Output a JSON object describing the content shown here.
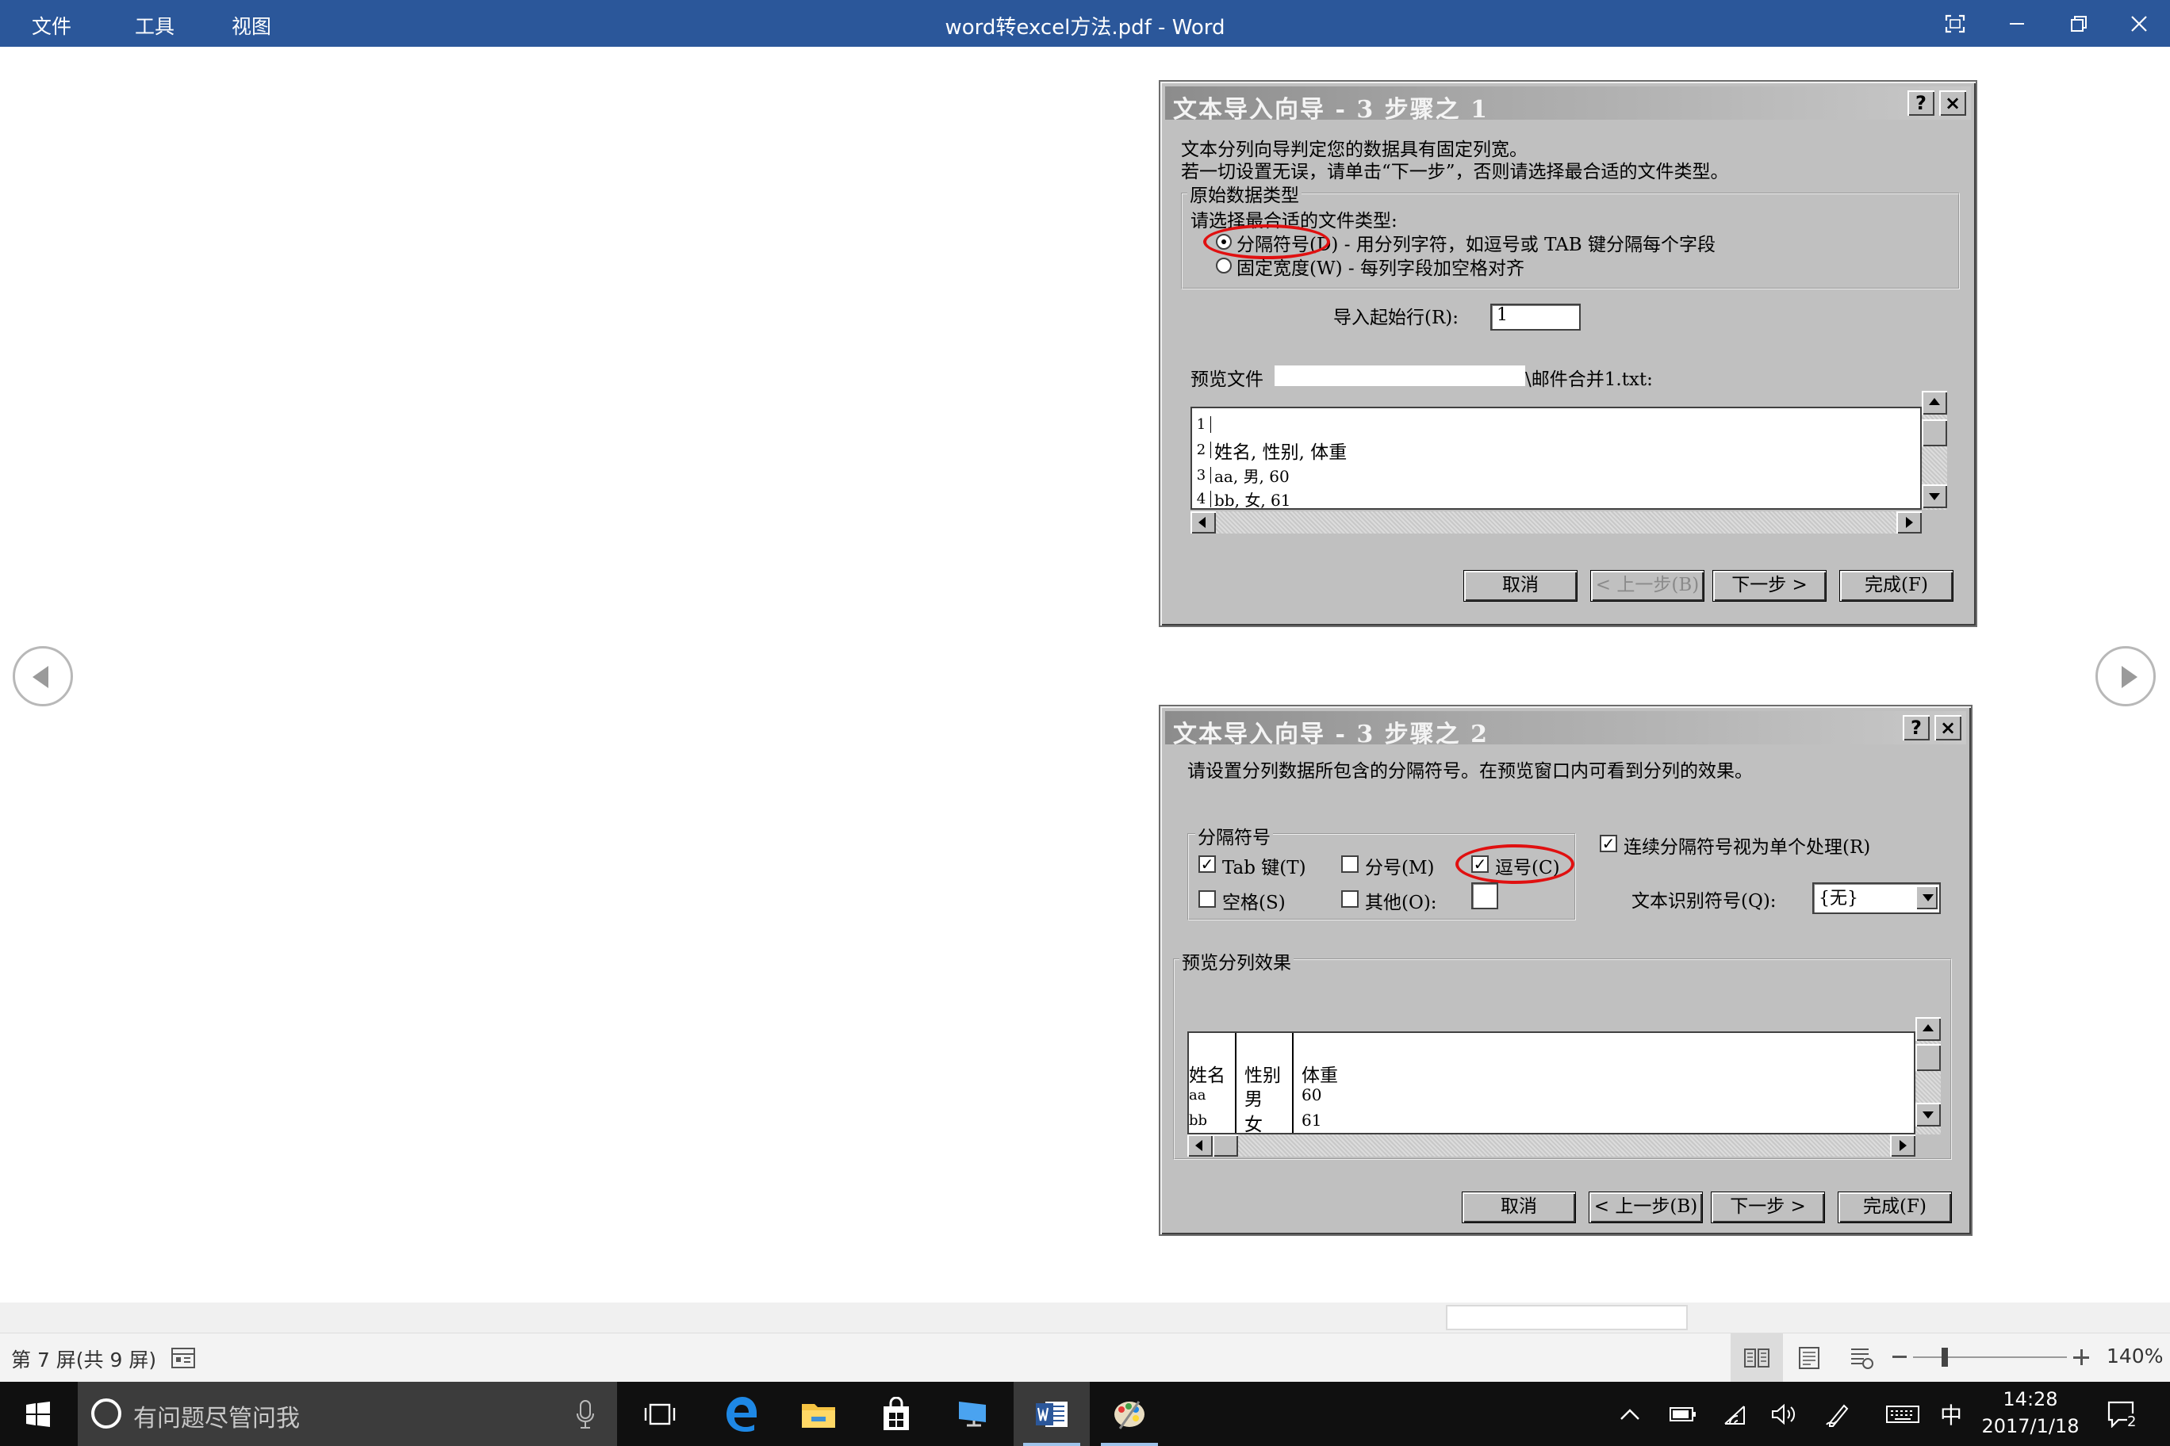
{
  "titlebar": {
    "menu": [
      "文件",
      "工具",
      "视图"
    ],
    "title": "word转excel方法.pdf  -  Word"
  },
  "dialog1": {
    "title": "文本导入向导 - 3 步骤之 1",
    "help": "?",
    "close": "×",
    "line1": "文本分列向导判定您的数据具有固定列宽。",
    "line2": "若一切设置无误，请单击“下一步”，否则请选择最合适的文件类型。",
    "group_label": "原始数据类型",
    "choose_label": "请选择最合适的文件类型:",
    "radio_delimited": "分隔符号(D) - 用分列字符，如逗号或 TAB 键分隔每个字段",
    "radio_fixed": "固定宽度(W) - 每列字段加空格对齐",
    "start_row_label": "导入起始行(R):",
    "start_row_value": "1",
    "preview_label": "预览文件",
    "preview_file": "\\邮件合并1.txt:",
    "preview_rows": [
      {
        "n": "1",
        "text": ""
      },
      {
        "n": "2",
        "text": "姓名, 性别, 体重"
      },
      {
        "n": "3",
        "text": "aa, 男, 60"
      },
      {
        "n": "4",
        "text": "bb, 女, 61"
      }
    ],
    "buttons": {
      "cancel": "取消",
      "back": "< 上一步(B)",
      "next": "下一步 >",
      "finish": "完成(F)"
    }
  },
  "dialog2": {
    "title": "文本导入向导 - 3 步骤之 2",
    "help": "?",
    "close": "×",
    "line1": "请设置分列数据所包含的分隔符号。在预览窗口内可看到分列的效果。",
    "group_label": "分隔符号",
    "chk_tab": "Tab 键(T)",
    "chk_semicolon": "分号(M)",
    "chk_comma": "逗号(C)",
    "chk_space": "空格(S)",
    "chk_other": "其他(O):",
    "chk_consecutive": "连续分隔符号视为单个处理(R)",
    "qualifier_label": "文本识别符号(Q):",
    "qualifier_value": "{无}",
    "preview_group": "预览分列效果",
    "preview_table": [
      [
        "姓名",
        "性别",
        "体重"
      ],
      [
        "aa",
        "男",
        "60"
      ],
      [
        "bb",
        "女",
        "61"
      ]
    ],
    "buttons": {
      "cancel": "取消",
      "back": "< 上一步(B)",
      "next": "下一步 >",
      "finish": "完成(F)"
    }
  },
  "status": {
    "page": "第 7 屏(共 9 屏)",
    "zoom": "140%"
  },
  "taskbar": {
    "search_placeholder": "有问题尽管问我",
    "ime": "中",
    "time": "14:28",
    "date": "2017/1/18",
    "notifications": "2"
  },
  "colors": {
    "word_blue": "#2b579a",
    "dialog_gray": "#c0c0c0",
    "red_circle": "#e01010",
    "taskbar": "#101010"
  }
}
